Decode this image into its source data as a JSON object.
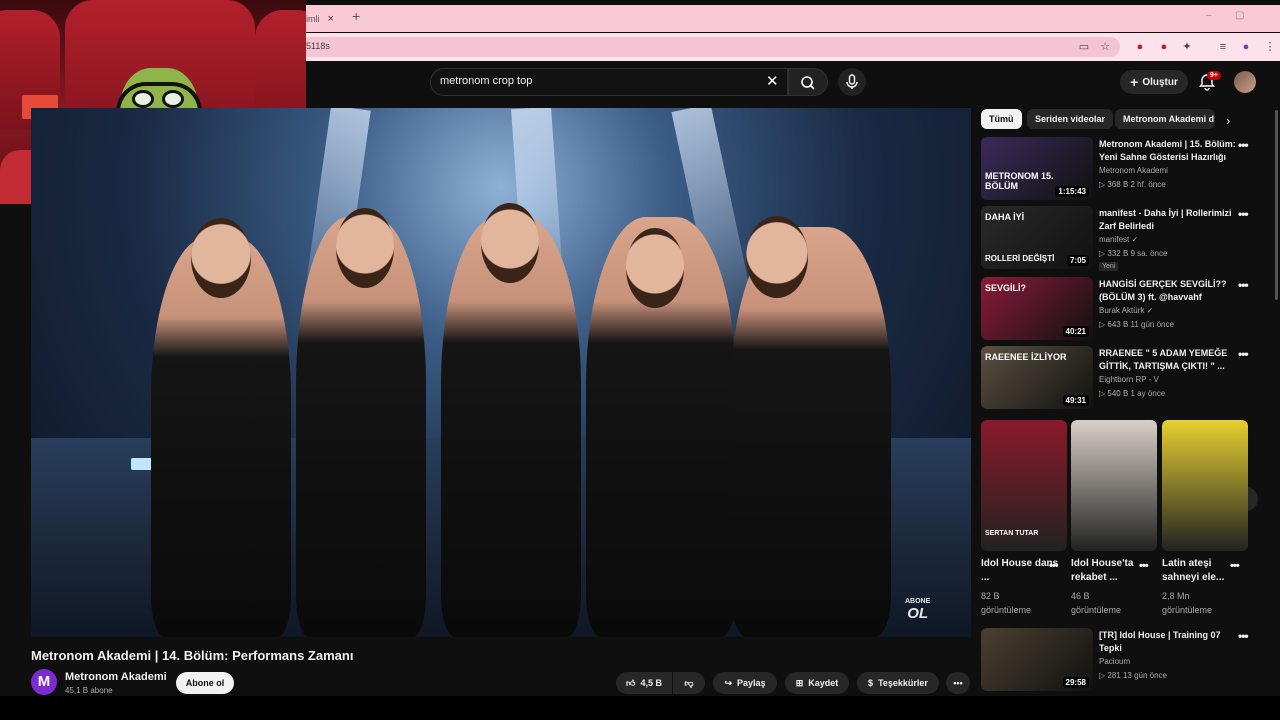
{
  "browser": {
    "tab_title": "imli",
    "tab_close": "×",
    "new_tab": "+",
    "url": "5118s",
    "window_min": "–",
    "window_max": "▢"
  },
  "header": {
    "search_query": "metronom crop top",
    "create_label": "Oluştur",
    "notif_count": "9+"
  },
  "video": {
    "title": "Metronom Akademi | 14. Bölüm: Performans Zamanı",
    "watermark_top": "ABONE",
    "watermark_bottom": "OL"
  },
  "channel": {
    "avatar_letter": "M",
    "name": "Metronom Akademi",
    "subscribers": "45,1 B abone",
    "subscribe_label": "Abone ol"
  },
  "actions": {
    "likes": "4,5 B",
    "share": "Paylaş",
    "save": "Kaydet",
    "thanks": "Teşekkürler",
    "more": "•••"
  },
  "chips": [
    "Tümü",
    "Seriden videolar",
    "Metronom Akademi d"
  ],
  "recommended": [
    {
      "thumb_text": "METRONOM 15. BÖLÜM",
      "duration": "1:15:43",
      "title": "Metronom Akademi | 15. Bölüm: Yeni Sahne Gösterisi Hazırlığı",
      "channel": "Metronom Akademi",
      "meta": "▷ 368 B   2 hf. önce",
      "color": "#3a2a5a"
    },
    {
      "thumb_text": "DAHA İYİ",
      "thumb_text2": "ROLLERİ DEĞİŞTİ",
      "duration": "7:05",
      "title": "manifest - Daha İyi | Rollerimizi Zarf Belirledi",
      "channel": "manifest ✓",
      "meta": "▷ 332 B   9 sa. önce",
      "badge": "Yeni",
      "color": "#2a2a2a"
    },
    {
      "thumb_text": "SEVGİLİ?",
      "duration": "40:21",
      "title": "HANGİSİ GERÇEK SEVGİLİ?? (BÖLÜM 3) ft. @havvahf",
      "channel": "Burak Aktürk ✓",
      "meta": "▷ 643 B   11 gün önce",
      "color": "#8a1a3a"
    },
    {
      "thumb_text": "RAEENEE İZLİYOR",
      "duration": "49:31",
      "title": "RRAENEE \" 5 ADAM YEMEĞE GİTTİK, TARTIŞMA ÇIKTI! \" ...",
      "channel": "Eightborn RP - V",
      "meta": "▷ 540 B   1 ay önce",
      "color": "#5a5040"
    },
    {
      "duration": "29:58",
      "title": "[TR] Idol House | Training 07 Tepki",
      "channel": "Pacioum",
      "meta": "▷ 281   13 gün önce",
      "color": "#4a4030"
    }
  ],
  "shorts": [
    {
      "title": "Idol House dans ...",
      "views": "82 B",
      "views_label": "görüntüleme",
      "thumb_text": "SERTAN TUTAR",
      "color": "#8a1a2a"
    },
    {
      "title": "Idol House'ta rekabet ...",
      "views": "46 B",
      "views_label": "görüntüleme",
      "color": "#d8d0c8"
    },
    {
      "title": "Latin ateşi sahneyi ele...",
      "views": "2,8 Mn",
      "views_label": "görüntüleme",
      "color": "#e8d030"
    }
  ],
  "colors": {
    "accent_red": "#cc0000",
    "tab_pink": "#f9c9d6",
    "yt_bg": "#0f0f0f",
    "channel_purple": "#7b2bd0"
  }
}
